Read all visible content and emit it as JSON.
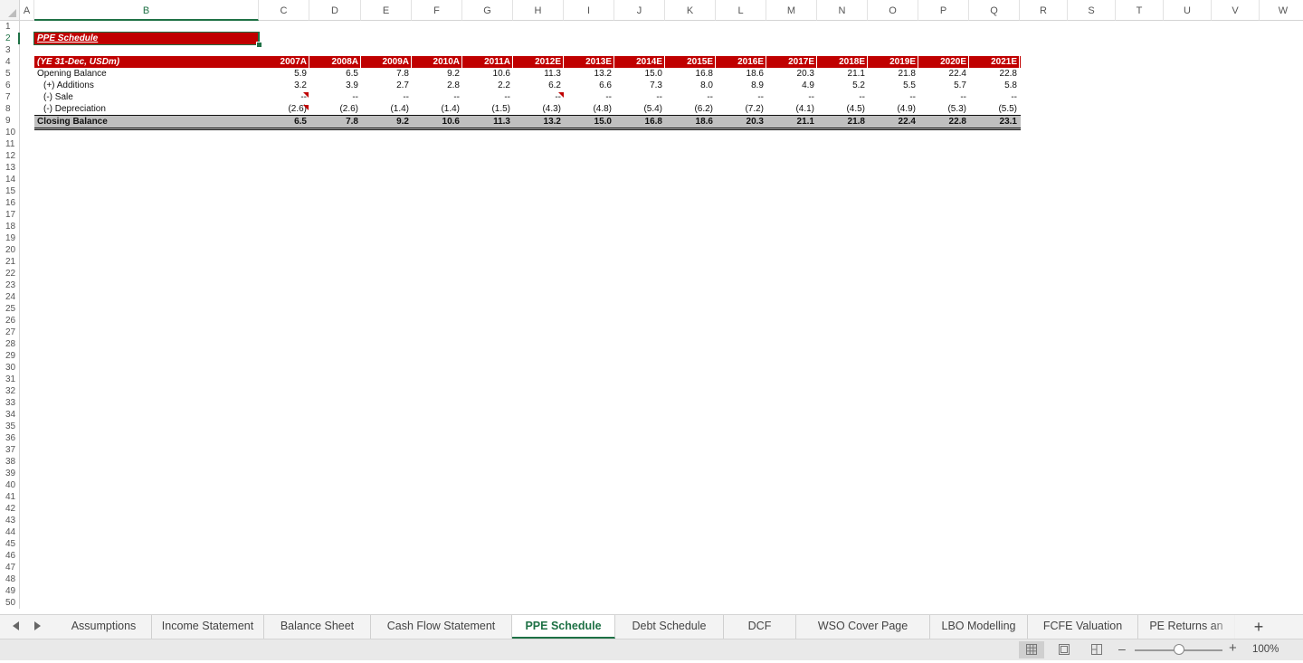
{
  "columns": [
    "A",
    "B",
    "C",
    "D",
    "E",
    "F",
    "G",
    "H",
    "I",
    "J",
    "K",
    "L",
    "M",
    "N",
    "O",
    "P",
    "Q",
    "R",
    "S",
    "T",
    "U",
    "V",
    "W"
  ],
  "active_column": "B",
  "rows": [
    "1",
    "2",
    "3",
    "4",
    "5",
    "6",
    "7",
    "8",
    "9",
    "10",
    "11",
    "12",
    "13",
    "14",
    "15",
    "16",
    "17",
    "18",
    "19",
    "20",
    "21",
    "22",
    "23",
    "24",
    "25",
    "26",
    "27",
    "28",
    "29",
    "30",
    "31",
    "32",
    "33",
    "34",
    "35",
    "36",
    "37",
    "38",
    "39",
    "40",
    "41",
    "42",
    "43",
    "44",
    "45",
    "46",
    "47",
    "48",
    "49",
    "50"
  ],
  "active_row": "2",
  "sheet": {
    "title": "PPE Schedule",
    "header_label": "(YE 31-Dec, USDm)",
    "years": [
      "2007A",
      "2008A",
      "2009A",
      "2010A",
      "2011A",
      "2012E",
      "2013E",
      "2014E",
      "2015E",
      "2016E",
      "2017E",
      "2018E",
      "2019E",
      "2020E",
      "2021E"
    ],
    "row_labels": {
      "opening": "Opening Balance",
      "additions": "(+) Additions",
      "sale": "(-) Sale",
      "depreciation": "(-) Depreciation",
      "closing": "Closing Balance"
    },
    "opening": [
      "5.9",
      "6.5",
      "7.8",
      "9.2",
      "10.6",
      "11.3",
      "13.2",
      "15.0",
      "16.8",
      "18.6",
      "20.3",
      "21.1",
      "21.8",
      "22.4",
      "22.8"
    ],
    "additions": [
      "3.2",
      "3.9",
      "2.7",
      "2.8",
      "2.2",
      "6.2",
      "6.6",
      "7.3",
      "8.0",
      "8.9",
      "4.9",
      "5.2",
      "5.5",
      "5.7",
      "5.8"
    ],
    "sale": [
      "--",
      "--",
      "--",
      "--",
      "--",
      "--",
      "--",
      "--",
      "--",
      "--",
      "--",
      "--",
      "--",
      "--",
      "--"
    ],
    "depreciation": [
      "(2.6)",
      "(2.6)",
      "(1.4)",
      "(1.4)",
      "(1.5)",
      "(4.3)",
      "(4.8)",
      "(5.4)",
      "(6.2)",
      "(7.2)",
      "(4.1)",
      "(4.5)",
      "(4.9)",
      "(5.3)",
      "(5.5)"
    ],
    "closing": [
      "6.5",
      "7.8",
      "9.2",
      "10.6",
      "11.3",
      "13.2",
      "15.0",
      "16.8",
      "18.6",
      "20.3",
      "21.1",
      "21.8",
      "22.4",
      "22.8",
      "23.1"
    ]
  },
  "tabs": [
    "Assumptions",
    "Income Statement",
    "Balance Sheet",
    "Cash Flow Statement",
    "PPE Schedule",
    "Debt Schedule",
    "DCF",
    "WSO Cover Page",
    "LBO Modelling",
    "FCFE Valuation",
    "PE Returns an"
  ],
  "active_tab": "PPE Schedule",
  "status": {
    "zoom": "100%",
    "zoom_fraction": 0.5,
    "views": [
      "normal-view-icon",
      "page-layout-view-icon",
      "page-break-view-icon"
    ]
  },
  "colors": {
    "accent": "#1e7145",
    "header_fill": "#c00000",
    "closing_fill": "#bfbfbf"
  }
}
